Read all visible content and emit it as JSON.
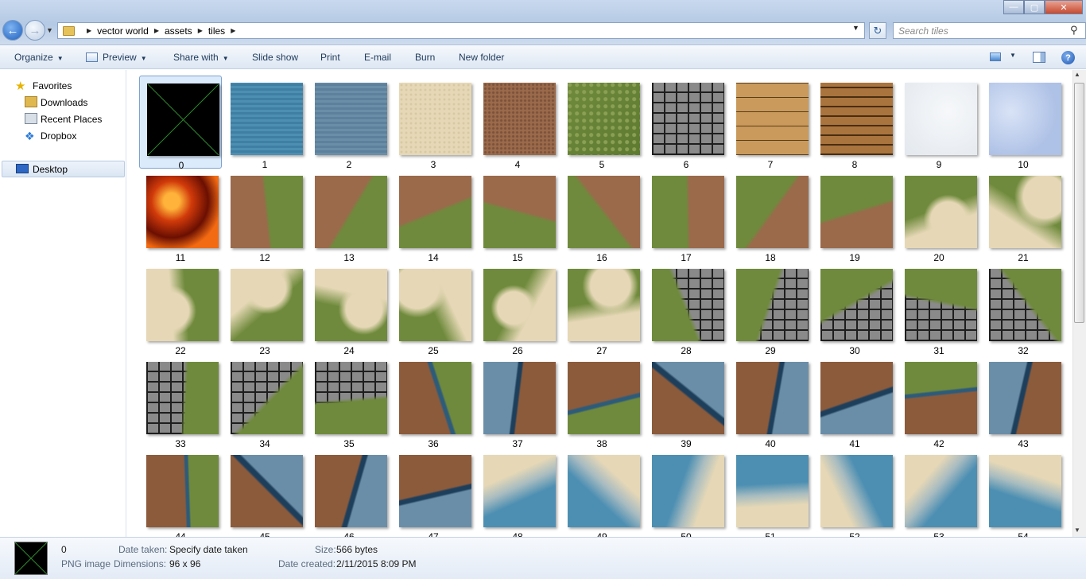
{
  "window": {
    "breadcrumbs": [
      "vector world",
      "assets",
      "tiles"
    ],
    "search_placeholder": "Search tiles"
  },
  "toolbar": {
    "organize": "Organize",
    "preview": "Preview",
    "share_with": "Share with",
    "slide_show": "Slide show",
    "print": "Print",
    "email": "E-mail",
    "burn": "Burn",
    "new_folder": "New folder"
  },
  "navpane": {
    "favorites": "Favorites",
    "downloads": "Downloads",
    "recent_places": "Recent Places",
    "dropbox": "Dropbox",
    "desktop": "Desktop"
  },
  "tiles": [
    {
      "label": "0",
      "kind": "placeholder"
    },
    {
      "label": "1",
      "kind": "water"
    },
    {
      "label": "2",
      "kind": "stillwater"
    },
    {
      "label": "3",
      "kind": "sand"
    },
    {
      "label": "4",
      "kind": "dirt"
    },
    {
      "label": "5",
      "kind": "grass"
    },
    {
      "label": "6",
      "kind": "cobble"
    },
    {
      "label": "7",
      "kind": "wood"
    },
    {
      "label": "8",
      "kind": "darkwood"
    },
    {
      "label": "9",
      "kind": "snow"
    },
    {
      "label": "10",
      "kind": "ice"
    },
    {
      "label": "11",
      "kind": "lava"
    },
    {
      "label": "12",
      "kind": "dirt-grass"
    },
    {
      "label": "13",
      "kind": "dirt-grass"
    },
    {
      "label": "14",
      "kind": "dirt-grass"
    },
    {
      "label": "15",
      "kind": "dirt-grass"
    },
    {
      "label": "16",
      "kind": "dirt-grass"
    },
    {
      "label": "17",
      "kind": "dirt-grass"
    },
    {
      "label": "18",
      "kind": "dirt-grass"
    },
    {
      "label": "19",
      "kind": "dirt-grass"
    },
    {
      "label": "20",
      "kind": "sand-grass"
    },
    {
      "label": "21",
      "kind": "sand-grass"
    },
    {
      "label": "22",
      "kind": "sand-grass"
    },
    {
      "label": "23",
      "kind": "sand-grass"
    },
    {
      "label": "24",
      "kind": "sand-grass"
    },
    {
      "label": "25",
      "kind": "sand-grass"
    },
    {
      "label": "26",
      "kind": "sand-grass"
    },
    {
      "label": "27",
      "kind": "sand-grass"
    },
    {
      "label": "28",
      "kind": "cobble-grass"
    },
    {
      "label": "29",
      "kind": "cobble-grass"
    },
    {
      "label": "30",
      "kind": "cobble-grass"
    },
    {
      "label": "31",
      "kind": "cobble-grass"
    },
    {
      "label": "32",
      "kind": "cobble-grass"
    },
    {
      "label": "33",
      "kind": "cobble-grass"
    },
    {
      "label": "34",
      "kind": "cobble-grass"
    },
    {
      "label": "35",
      "kind": "cobble-grass"
    },
    {
      "label": "36",
      "kind": "rock-grass"
    },
    {
      "label": "37",
      "kind": "rock-water"
    },
    {
      "label": "38",
      "kind": "rock-grass"
    },
    {
      "label": "39",
      "kind": "rock-water"
    },
    {
      "label": "40",
      "kind": "rock-water"
    },
    {
      "label": "41",
      "kind": "rock-water"
    },
    {
      "label": "42",
      "kind": "rock-grass"
    },
    {
      "label": "43",
      "kind": "rock-water"
    },
    {
      "label": "44",
      "kind": "rock-grass"
    },
    {
      "label": "45",
      "kind": "rock-water"
    },
    {
      "label": "46",
      "kind": "rock-water"
    },
    {
      "label": "47",
      "kind": "rock-water"
    },
    {
      "label": "48",
      "kind": "water-sand"
    },
    {
      "label": "49",
      "kind": "water-sand"
    },
    {
      "label": "50",
      "kind": "water-sand"
    },
    {
      "label": "51",
      "kind": "water-sand"
    },
    {
      "label": "52",
      "kind": "water-sand"
    },
    {
      "label": "53",
      "kind": "water-sand"
    },
    {
      "label": "54",
      "kind": "water-sand"
    }
  ],
  "details": {
    "name": "0",
    "type": "PNG image",
    "date_taken_label": "Date taken:",
    "date_taken_value": "Specify date taken",
    "dimensions_label": "Dimensions:",
    "dimensions_value": "96 x 96",
    "size_label": "Size:",
    "size_value": "566 bytes",
    "date_created_label": "Date created:",
    "date_created_value": "2/11/2015 8:09 PM"
  },
  "colors": {
    "selection": "#dcebfc",
    "accent": "#1e395b"
  }
}
